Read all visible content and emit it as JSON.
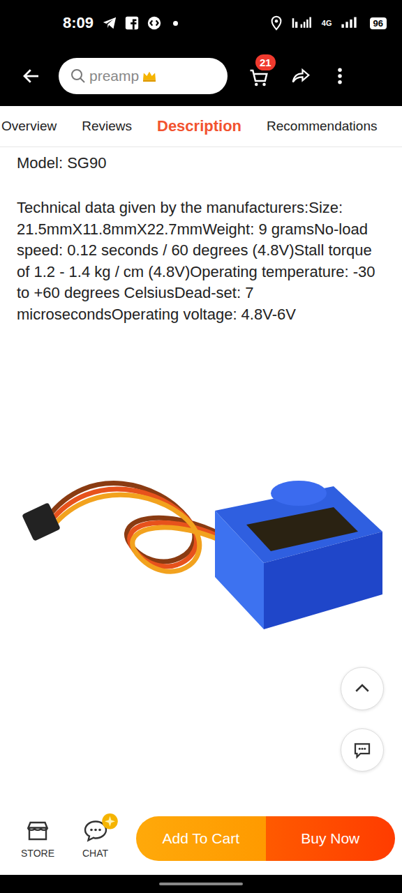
{
  "status_bar": {
    "time": "8:09",
    "network": "4G",
    "battery": "96"
  },
  "search": {
    "placeholder": "preamp"
  },
  "cart": {
    "count": "21"
  },
  "tabs": [
    {
      "label": "Overview",
      "selected": false
    },
    {
      "label": "Reviews",
      "selected": false
    },
    {
      "label": "Description",
      "selected": true
    },
    {
      "label": "Recommendations",
      "selected": false
    }
  ],
  "description": {
    "model": "Model: SG90",
    "text": "Technical data given by the manufacturers:Size: 21.5mmX11.8mmX22.7mmWeight: 9 gramsNo-load speed: 0.12 seconds / 60 degrees (4.8V)Stall torque of 1.2 - 1.4 kg / cm (4.8V)Operating temperature: -30 to +60 degrees CelsiusDead-set: 7 microsecondsOperating voltage: 4.8V-6V"
  },
  "bottom_bar": {
    "store": "STORE",
    "chat": "CHAT",
    "add_to_cart": "Add To Cart",
    "buy_now": "Buy Now"
  }
}
